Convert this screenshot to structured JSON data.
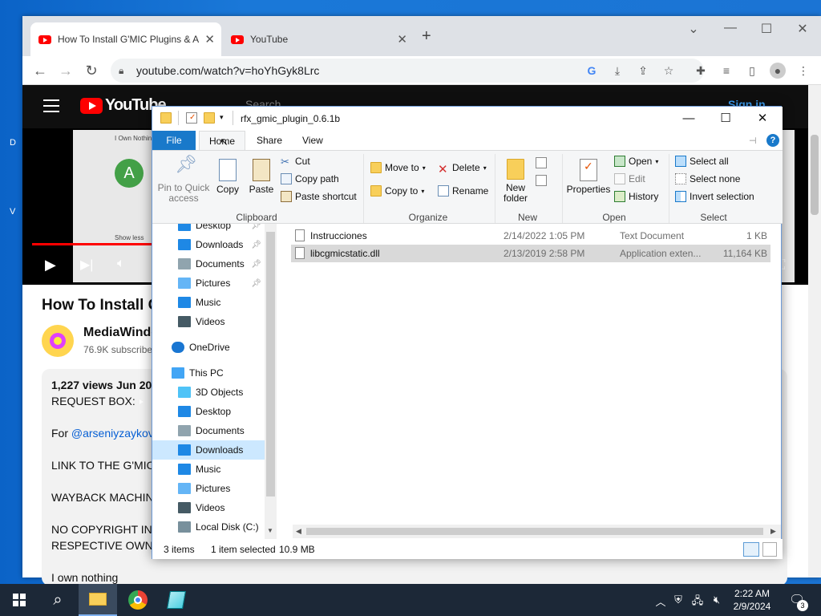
{
  "desktop": {
    "left_letters": [
      "D",
      "V"
    ]
  },
  "chrome": {
    "tabs": [
      {
        "title": "How To Install G'MIC Plugins & A"
      },
      {
        "title": "YouTube"
      }
    ],
    "new_tab_label": "+",
    "url": "youtube.com/watch?v=hoYhGyk8Lrc"
  },
  "youtube": {
    "logo_text": "YouTube",
    "search_placeholder": "Search",
    "sign_in": "Sign in",
    "video_overlay": {
      "line1": "I Own Nothing",
      "avatar_letter": "A",
      "show_less": "Show less"
    },
    "video_title": "How To Install G",
    "channel_name": "MediaWindo",
    "channel_subs": "76.9K subscribe",
    "description": {
      "stats": "1,227 views  Jun 20,",
      "request_box": "REQUEST BOX:",
      "for_prefix": "For ",
      "mention": "@arseniyzaykov",
      "link_line": "LINK TO THE G'MIC",
      "wayback": "WAYBACK MACHINE",
      "copyright1": "NO COPYRIGHT INF",
      "copyright2": "RESPECTIVE OWNE",
      "own_nothing": "I own nothing"
    }
  },
  "explorer": {
    "title": "rfx_gmic_plugin_0.6.1b",
    "ribbon_tabs": {
      "file": "File",
      "home": "Home",
      "share": "Share",
      "view": "View"
    },
    "clipboard": {
      "label": "Clipboard",
      "pin": "Pin to Quick access",
      "copy": "Copy",
      "paste": "Paste",
      "cut": "Cut",
      "copy_path": "Copy path",
      "paste_shortcut": "Paste shortcut"
    },
    "organize": {
      "label": "Organize",
      "move_to": "Move to",
      "copy_to": "Copy to",
      "delete": "Delete",
      "rename": "Rename"
    },
    "new": {
      "label": "New",
      "new_folder": "New folder"
    },
    "open": {
      "label": "Open",
      "properties": "Properties",
      "open": "Open",
      "edit": "Edit",
      "history": "History"
    },
    "select": {
      "label": "Select",
      "select_all": "Select all",
      "select_none": "Select none",
      "invert": "Invert selection"
    },
    "nav_items": [
      {
        "label": "Desktop",
        "icon": "desktop-icon",
        "pinned": true
      },
      {
        "label": "Downloads",
        "icon": "download-icon",
        "pinned": true
      },
      {
        "label": "Documents",
        "icon": "document-icon",
        "pinned": true
      },
      {
        "label": "Pictures",
        "icon": "pictures-icon",
        "pinned": true
      },
      {
        "label": "Music",
        "icon": "music-icon",
        "pinned": false
      },
      {
        "label": "Videos",
        "icon": "videos-icon",
        "pinned": false
      },
      {
        "label": "OneDrive",
        "icon": "cloud-icon",
        "pinned": false
      },
      {
        "label": "This PC",
        "icon": "computer-icon",
        "pinned": false
      },
      {
        "label": "3D Objects",
        "icon": "cube-icon",
        "pinned": false
      },
      {
        "label": "Desktop",
        "icon": "desktop-icon",
        "pinned": false
      },
      {
        "label": "Documents",
        "icon": "document-icon",
        "pinned": false
      },
      {
        "label": "Downloads",
        "icon": "download-icon",
        "pinned": false,
        "selected": true
      },
      {
        "label": "Music",
        "icon": "music-icon",
        "pinned": false
      },
      {
        "label": "Pictures",
        "icon": "pictures-icon",
        "pinned": false
      },
      {
        "label": "Videos",
        "icon": "videos-icon",
        "pinned": false
      },
      {
        "label": "Local Disk (C:)",
        "icon": "disk-icon",
        "pinned": false
      }
    ],
    "files": [
      {
        "name": "Instrucciones",
        "date": "2/14/2022 1:05 PM",
        "type": "Text Document",
        "size": "1 KB",
        "selected": false
      },
      {
        "name": "libcgmicstatic.dll",
        "date": "2/13/2019 2:58 PM",
        "type": "Application exten...",
        "size": "11,164 KB",
        "selected": true
      }
    ],
    "status": {
      "count": "3 items",
      "selected": "1 item selected",
      "size": "10.9 MB"
    }
  },
  "taskbar": {
    "time": "2:22 AM",
    "date": "2/9/2024",
    "notification_count": "3"
  }
}
